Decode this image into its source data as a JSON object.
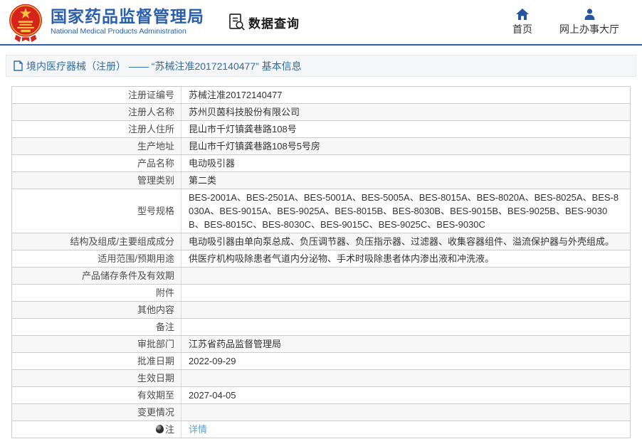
{
  "colors": {
    "brand-blue": "#2b5fae",
    "nav-blue": "#2456a4",
    "breadcrumb-blue": "#2e6da4",
    "link-blue": "#55a0e0",
    "emblem-red": "#d6231c",
    "emblem-gold": "#f5c542",
    "row-alt-bg": "#f7f7f7",
    "border-gray": "#cccccc",
    "text-dark": "#333333",
    "label-gray": "#4d4d4d"
  },
  "header": {
    "agency_name_cn": "国家药品监督管理局",
    "agency_name_en": "National Medical Products Administration",
    "data_query_label": "数据查询",
    "nav_home": "首页",
    "nav_service_hall": "网上办事大厅"
  },
  "breadcrumb": {
    "text": "境内医疗器械（注册） —— “苏械注准20172140477” 基本信息"
  },
  "table": {
    "rows": [
      {
        "label": "注册证编号",
        "value": "苏械注准20172140477"
      },
      {
        "label": "注册人名称",
        "value": "苏州贝茵科技股份有限公司"
      },
      {
        "label": "注册人住所",
        "value": "昆山市千灯镇龚巷路108号"
      },
      {
        "label": "生产地址",
        "value": "昆山市千灯镇龚巷路108号5号房"
      },
      {
        "label": "产品名称",
        "value": "电动吸引器"
      },
      {
        "label": "管理类别",
        "value": "第二类"
      },
      {
        "label": "型号规格",
        "value": "BES-2001A、BES-2501A、BES-5001A、BES-5005A、BES-8015A、BES-8020A、BES-8025A、BES-8030A、BES-9015A、BES-9025A、BES-8015B、BES-8030B、BES-9015B、BES-9025B、BES-9030B、BES-8015C、BES-8030C、BES-9015C、BES-9025C、BES-9030C"
      },
      {
        "label": "结构及组成/主要组成成分",
        "value": "电动吸引器由单向泵总成、负压调节器、负压指示器、过滤器、收集容器组件、溢流保护器与外壳组成。"
      },
      {
        "label": "适用范围/预期用途",
        "value": "供医疗机构吸除患者气道内分泌物、手术时吸除患者体内渗出液和冲洗液。"
      },
      {
        "label": "产品储存条件及有效期",
        "value": ""
      },
      {
        "label": "附件",
        "value": ""
      },
      {
        "label": "其他内容",
        "value": ""
      },
      {
        "label": "备注",
        "value": ""
      },
      {
        "label": "审批部门",
        "value": "江苏省药品监督管理局"
      },
      {
        "label": "批准日期",
        "value": "2022-09-29"
      },
      {
        "label": "生效日期",
        "value": ""
      },
      {
        "label": "有效期至",
        "value": "2027-04-05"
      },
      {
        "label": "变更情况",
        "value": ""
      },
      {
        "label": "注",
        "label_icon": "bulb-icon",
        "value": "详情",
        "link": true
      }
    ]
  }
}
